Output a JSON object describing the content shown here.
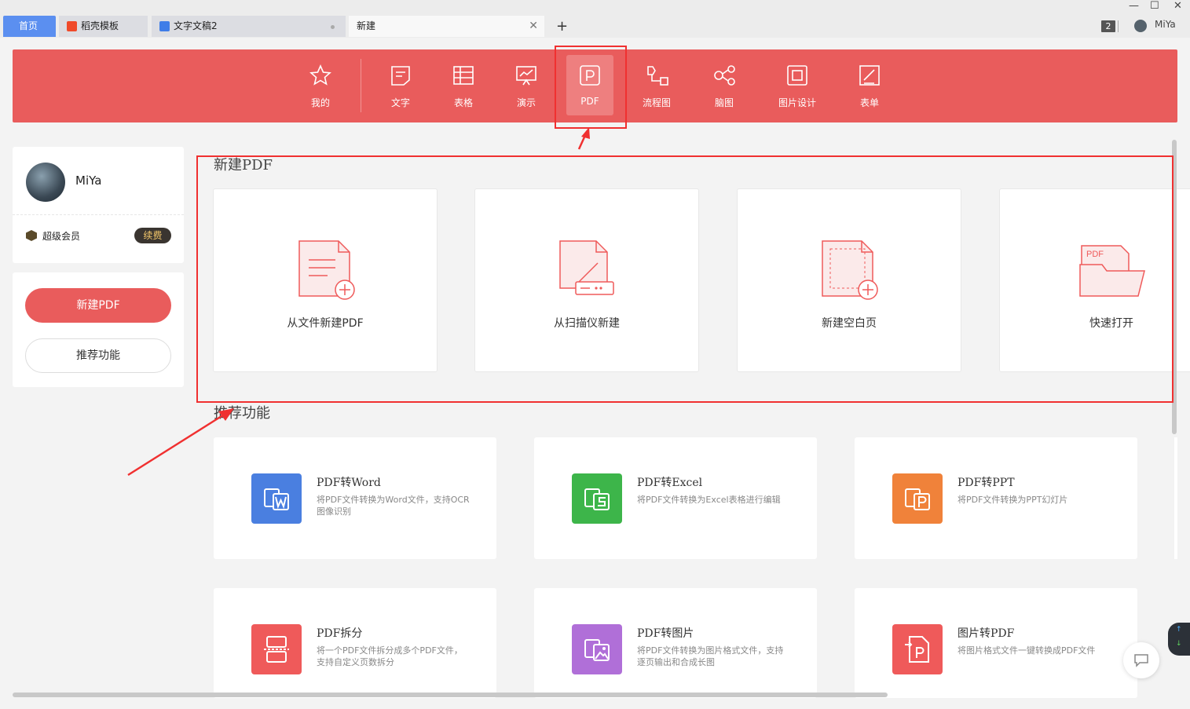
{
  "tabs": [
    {
      "label": "首页",
      "icon": "home"
    },
    {
      "label": "稻壳模板",
      "icon": "docer-flame-icon"
    },
    {
      "label": "文字文稿2",
      "icon": "word-doc-icon"
    },
    {
      "label": "新建",
      "icon": ""
    }
  ],
  "window": {
    "badge": "2",
    "user": "MiYa"
  },
  "ribbon": {
    "items": [
      {
        "label": "我的",
        "icon": "star-icon"
      },
      {
        "label": "文字",
        "icon": "doc-icon"
      },
      {
        "label": "表格",
        "icon": "table-icon"
      },
      {
        "label": "演示",
        "icon": "presentation-icon"
      },
      {
        "label": "PDF",
        "icon": "pdf-icon",
        "selected": true
      },
      {
        "label": "流程图",
        "icon": "flowchart-icon"
      },
      {
        "label": "脑图",
        "icon": "mindmap-icon"
      },
      {
        "label": "图片设计",
        "icon": "image-design-icon"
      },
      {
        "label": "表单",
        "icon": "form-icon"
      }
    ]
  },
  "user": {
    "name": "MiYa",
    "member_label": "超级会员",
    "renew_label": "续费"
  },
  "left_actions": {
    "primary": "新建PDF",
    "secondary": "推荐功能"
  },
  "new_pdf": {
    "title": "新建PDF",
    "cards": [
      {
        "label": "从文件新建PDF",
        "icon": "new-from-file-icon"
      },
      {
        "label": "从扫描仪新建",
        "icon": "scanner-icon"
      },
      {
        "label": "新建空白页",
        "icon": "blank-page-icon"
      },
      {
        "label": "快速打开",
        "icon": "pdf-folder-icon"
      }
    ]
  },
  "recommended": {
    "title": "推荐功能",
    "items": [
      {
        "title": "PDF转Word",
        "desc": "将PDF文件转换为Word文件，支持OCR图像识别",
        "color": "#4a7fe0",
        "icon": "pdf-to-word-icon"
      },
      {
        "title": "PDF转Excel",
        "desc": "将PDF文件转换为Excel表格进行编辑",
        "color": "#3db54a",
        "icon": "pdf-to-excel-icon"
      },
      {
        "title": "PDF转PPT",
        "desc": "将PDF文件转换为PPT幻灯片",
        "color": "#f0823a",
        "icon": "pdf-to-ppt-icon"
      },
      {
        "title": "PDF拆分",
        "desc": "将一个PDF文件拆分成多个PDF文件，支持自定义页数拆分",
        "color": "#ef5a5a",
        "icon": "pdf-split-icon"
      },
      {
        "title": "PDF转图片",
        "desc": "将PDF文件转换为图片格式文件，支持逐页输出和合成长图",
        "color": "#b06fd8",
        "icon": "pdf-to-image-icon"
      },
      {
        "title": "图片转PDF",
        "desc": "将图片格式文件一键转换成PDF文件",
        "color": "#ef5a5a",
        "icon": "image-to-pdf-icon"
      }
    ]
  },
  "colors": {
    "brand_red": "#e95c5c",
    "annotation_red": "#f03030"
  }
}
